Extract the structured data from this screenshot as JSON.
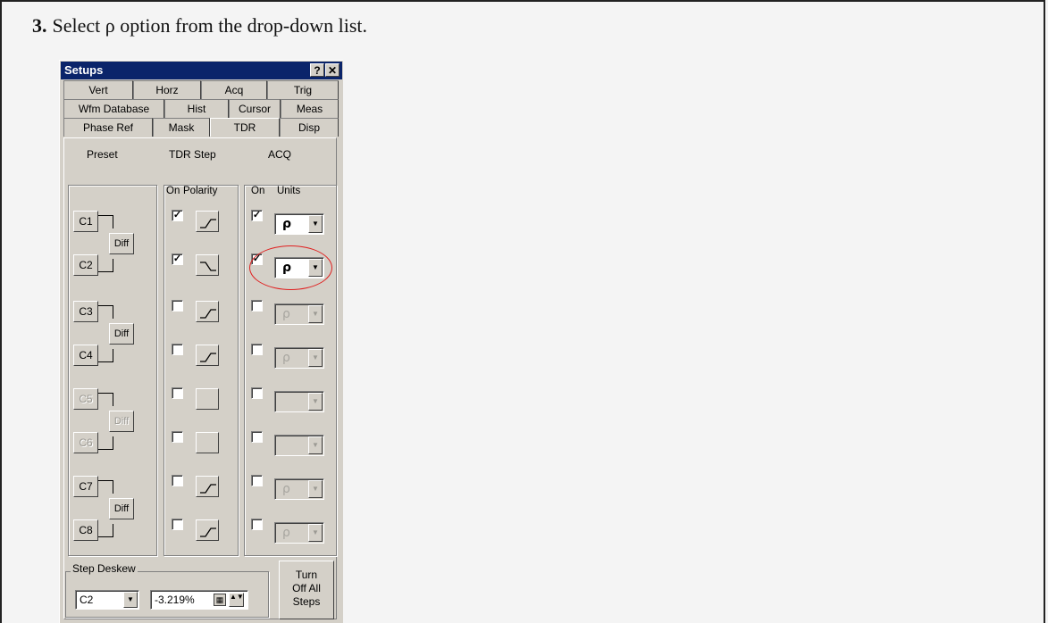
{
  "instruction": {
    "number": "3.",
    "text": "Select ρ option from the drop-down list."
  },
  "dialog": {
    "title": "Setups",
    "help_label": "?",
    "close_label": "✕",
    "tabs_row1": [
      "Vert",
      "Horz",
      "Acq",
      "Trig"
    ],
    "tabs_row2": [
      "Wfm Database",
      "Hist",
      "Cursor",
      "Meas"
    ],
    "tabs_row3": [
      "Phase Ref",
      "Mask",
      "TDR",
      "Disp"
    ],
    "active_tab": "TDR",
    "headers": {
      "preset": "Preset",
      "tdr_step": "TDR Step",
      "acq": "ACQ"
    },
    "subheaders": {
      "on1": "On",
      "polarity": "Polarity",
      "on2": "On",
      "units": "Units"
    },
    "diff_label": "Diff",
    "channels": [
      {
        "name": "C1",
        "step_on": true,
        "polarity": "rise",
        "acq_on": true,
        "units": "ρ",
        "enabled": true
      },
      {
        "name": "C2",
        "step_on": true,
        "polarity": "fall",
        "acq_on": true,
        "units": "ρ",
        "enabled": true
      },
      {
        "name": "C3",
        "step_on": false,
        "polarity": "rise",
        "acq_on": false,
        "units": "ρ",
        "enabled": true
      },
      {
        "name": "C4",
        "step_on": false,
        "polarity": "rise",
        "acq_on": false,
        "units": "ρ",
        "enabled": true
      },
      {
        "name": "C5",
        "step_on": false,
        "polarity": "none",
        "acq_on": false,
        "units": "",
        "enabled": false
      },
      {
        "name": "C6",
        "step_on": false,
        "polarity": "none",
        "acq_on": false,
        "units": "",
        "enabled": false
      },
      {
        "name": "C7",
        "step_on": false,
        "polarity": "rise",
        "acq_on": false,
        "units": "ρ",
        "enabled": true
      },
      {
        "name": "C8",
        "step_on": false,
        "polarity": "rise",
        "acq_on": false,
        "units": "ρ",
        "enabled": true
      }
    ],
    "step_deskew": {
      "label": "Step Deskew",
      "channel": "C2",
      "value": "-3.219%"
    },
    "turn_off": [
      "Turn",
      "Off All",
      "Steps"
    ],
    "check_mark": "✓",
    "dropdown_arrow": "▼",
    "keypad_icon": "▦",
    "spin_icon": "▲▼"
  }
}
